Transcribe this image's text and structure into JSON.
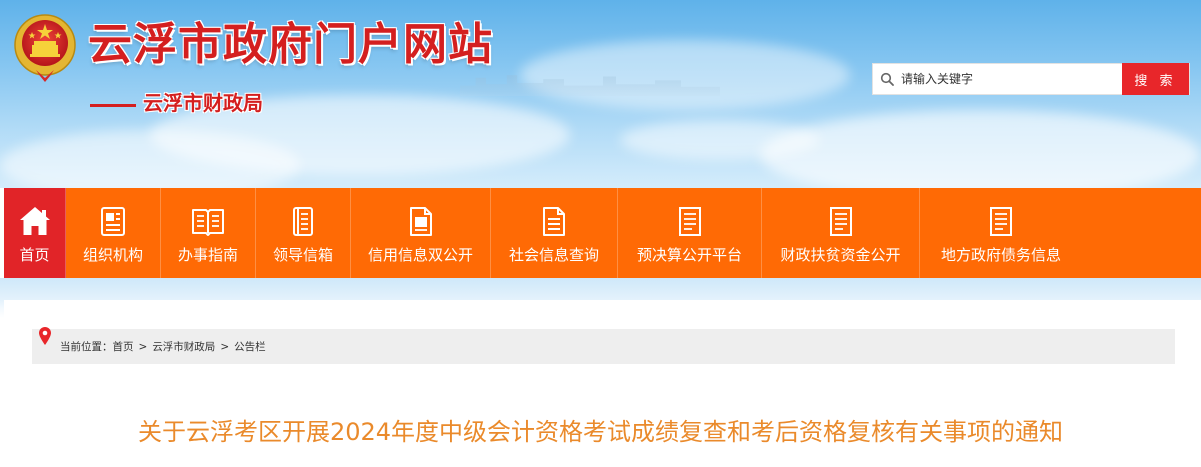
{
  "header": {
    "site_title": "云浮市政府门户网站",
    "department": "云浮市财政局"
  },
  "search": {
    "placeholder": "请输入关键字",
    "button_label": "搜 索"
  },
  "nav": {
    "items": [
      {
        "label": "首页",
        "icon": "home-icon",
        "active": true
      },
      {
        "label": "组织机构",
        "icon": "org-icon"
      },
      {
        "label": "办事指南",
        "icon": "book-icon"
      },
      {
        "label": "领导信箱",
        "icon": "mailbox-icon"
      },
      {
        "label": "信用信息双公开",
        "icon": "doc-icon"
      },
      {
        "label": "社会信息查询",
        "icon": "doc-list-icon"
      },
      {
        "label": "预决算公开平台",
        "icon": "doc-icon"
      },
      {
        "label": "财政扶贫资金公开",
        "icon": "doc-icon"
      },
      {
        "label": "地方政府债务信息",
        "icon": "doc-icon"
      }
    ]
  },
  "breadcrumb": {
    "prefix": "当前位置：",
    "items": [
      "首页",
      "云浮市财政局",
      "公告栏"
    ],
    "separator": ">"
  },
  "article": {
    "title": "关于云浮考区开展2024年度中级会计资格考试成绩复查和考后资格复核有关事项的通知"
  },
  "colors": {
    "brand_red": "#d41f1f",
    "nav_orange": "#ff6a05",
    "nav_active": "#e12428",
    "title_orange": "#ea8a2b"
  }
}
